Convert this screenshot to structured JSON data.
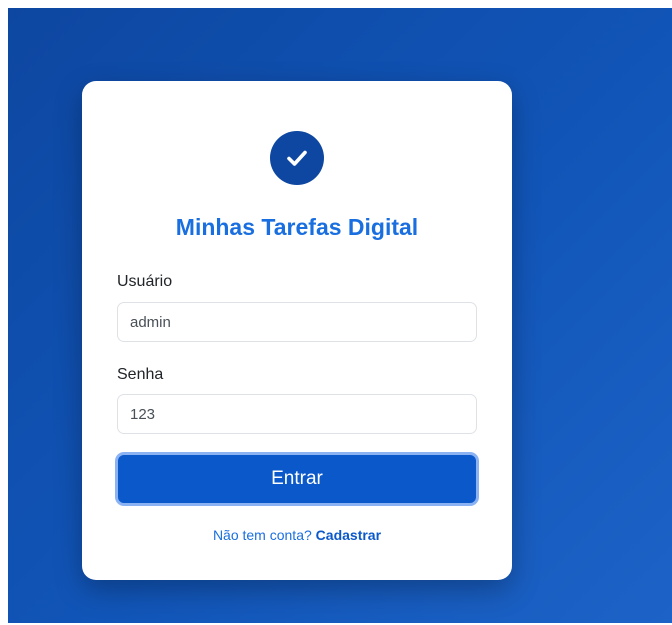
{
  "app": {
    "title": "Minhas Tarefas Digital",
    "logo_icon": "check-circle-icon"
  },
  "form": {
    "username_label": "Usuário",
    "username_value": "admin",
    "password_label": "Senha",
    "password_value": "123",
    "submit_label": "Entrar"
  },
  "footer": {
    "prompt": "Não tem conta?",
    "link_label": "Cadastrar"
  },
  "colors": {
    "background": "#0d47a1",
    "accent": "#1a6fe0",
    "button": "#0a58ca",
    "button_focus_ring": "#8bb3f4"
  }
}
